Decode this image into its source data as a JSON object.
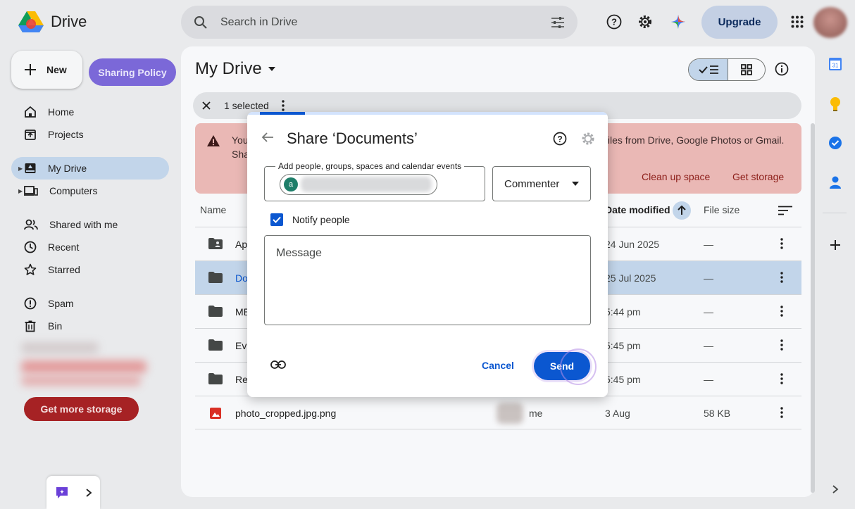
{
  "app": {
    "name": "Drive"
  },
  "search": {
    "placeholder": "Search in Drive"
  },
  "topbar": {
    "upgrade_label": "Upgrade"
  },
  "sidebar": {
    "new_label": "New",
    "policy_label": "Sharing Policy",
    "items": [
      {
        "label": "Home",
        "icon": "home-icon"
      },
      {
        "label": "Projects",
        "icon": "projects-icon"
      },
      {
        "label": "My Drive",
        "icon": "my-drive-icon"
      },
      {
        "label": "Computers",
        "icon": "computers-icon"
      },
      {
        "label": "Shared with me",
        "icon": "shared-icon"
      },
      {
        "label": "Recent",
        "icon": "clock-icon"
      },
      {
        "label": "Starred",
        "icon": "star-icon"
      },
      {
        "label": "Spam",
        "icon": "spam-icon"
      },
      {
        "label": "Bin",
        "icon": "bin-icon"
      }
    ],
    "storage_button": "Get more storage"
  },
  "main": {
    "title": "My Drive",
    "selection": "1 selected",
    "banner": {
      "line1_start": "You",
      "line1_end": "files from Drive, Google Photos or Gmail.",
      "line2_start": "Sha",
      "clean_up": "Clean up space",
      "get_storage": "Get storage"
    },
    "columns": {
      "name": "Name",
      "date": "Date modified",
      "size": "File size"
    },
    "rows": [
      {
        "name": "Ap",
        "date": "24 Jun 2025",
        "size": "—"
      },
      {
        "name": "Do",
        "date": "25 Jul 2025",
        "size": "—"
      },
      {
        "name": "ME",
        "date": "5:44 pm",
        "size": "—"
      },
      {
        "name": "Eva",
        "date": "5:45 pm",
        "size": "—"
      },
      {
        "name": "Re",
        "date": "5:45 pm",
        "size": "—"
      },
      {
        "name": "photo_cropped.jpg.png",
        "owner": "me",
        "date": "3 Aug",
        "size": "58 KB"
      }
    ]
  },
  "dialog": {
    "title": "Share ‘Documents’",
    "field_label": "Add people, groups, spaces and calendar events",
    "chip_initial": "a",
    "role": "Commenter",
    "notify_label": "Notify people",
    "notify_checked": true,
    "message_placeholder": "Message",
    "cancel_label": "Cancel",
    "send_label": "Send"
  },
  "colors": {
    "accent": "#0b57d0",
    "selected_row": "#c2d5ea",
    "banner": "#eab8b5",
    "policy": "#7b68d8"
  }
}
